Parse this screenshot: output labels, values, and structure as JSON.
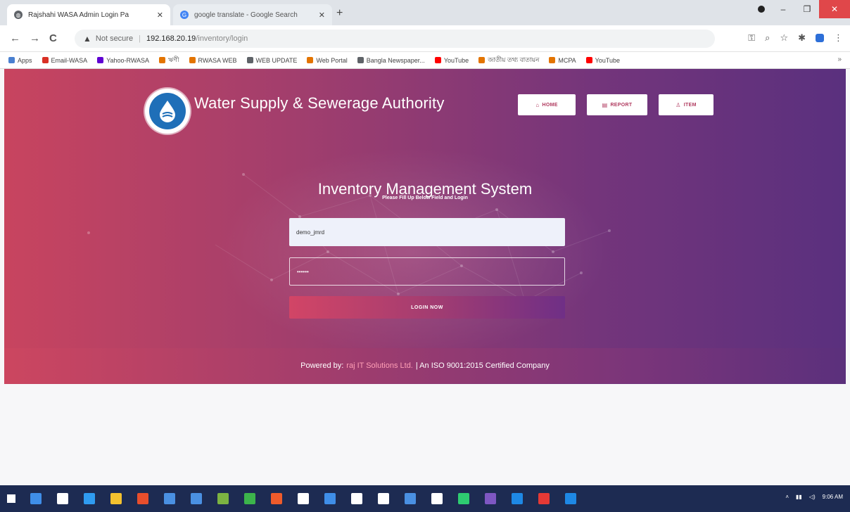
{
  "browser": {
    "tabs": [
      {
        "title": "Rajshahi WASA Admin Login Pa",
        "active": true
      },
      {
        "title": "google translate - Google Search",
        "active": false
      }
    ],
    "new_tab": "+",
    "window_buttons": {
      "minimize": "–",
      "maximize": "❐",
      "close": "✕"
    },
    "nav": {
      "back": "←",
      "forward": "→",
      "reload": "C"
    },
    "url": {
      "security": "Not secure",
      "host": "192.168.20.19",
      "path": "/inventory/login"
    },
    "bookmarks": [
      {
        "label": "Apps",
        "color": "#4a80d0"
      },
      {
        "label": "Email-WASA",
        "color": "#d93025"
      },
      {
        "label": "Yahoo-RWASA",
        "color": "#6001d2"
      },
      {
        "label": "ঋণী",
        "color": "#e37400"
      },
      {
        "label": "RWASA WEB",
        "color": "#e37400"
      },
      {
        "label": "WEB UPDATE",
        "color": "#5f6368"
      },
      {
        "label": "Web Portal",
        "color": "#e37400"
      },
      {
        "label": "Bangla Newspaper...",
        "color": "#5f6368"
      },
      {
        "label": "YouTube",
        "color": "#ff0000"
      },
      {
        "label": "জাতীয় তথ্য বাতায়ন",
        "color": "#e37400"
      },
      {
        "label": "MCPA",
        "color": "#e37400"
      },
      {
        "label": "YouTube",
        "color": "#ff0000"
      }
    ],
    "bookmarks_more": "»"
  },
  "header": {
    "brand": "Water Supply & Sewerage Authority",
    "nav": [
      {
        "label": "HOME",
        "icon": "home-icon",
        "glyph": "⌂"
      },
      {
        "label": "REPORT",
        "icon": "report-icon",
        "glyph": "▤"
      },
      {
        "label": "ITEM",
        "icon": "user-icon",
        "glyph": "♙"
      }
    ]
  },
  "login": {
    "title": "Inventory Management System",
    "subtitle": "Please Fill Up Below Field and Login",
    "username_value": "demo_jmrd",
    "password_value": "••••••",
    "button": "LOGIN NOW"
  },
  "footer": {
    "prefix": "Powered by:",
    "company": "raj IT Solutions Ltd.",
    "suffix": "| An ISO 9001:2015 Certified Company"
  },
  "taskbar": {
    "clock": "9:06 AM",
    "icon_colors": [
      "#3f8ee8",
      "#ffffff",
      "#2f9bf0",
      "#f3c12f",
      "#e84e2c",
      "#4a90e2",
      "#4a90e2",
      "#7cb342",
      "#3cb44b",
      "#ef5b2b",
      "#ffffff",
      "#3f8ee8",
      "#ffffff",
      "#ffffff",
      "#4a90e2",
      "#ffffff",
      "#2ecc71",
      "#7e57c2",
      "#1e88e5",
      "#e53935",
      "#1e88e5"
    ]
  },
  "colors": {
    "hero_start": "#c8445f",
    "hero_end": "#5a307e",
    "accent": "#b03a5f"
  }
}
